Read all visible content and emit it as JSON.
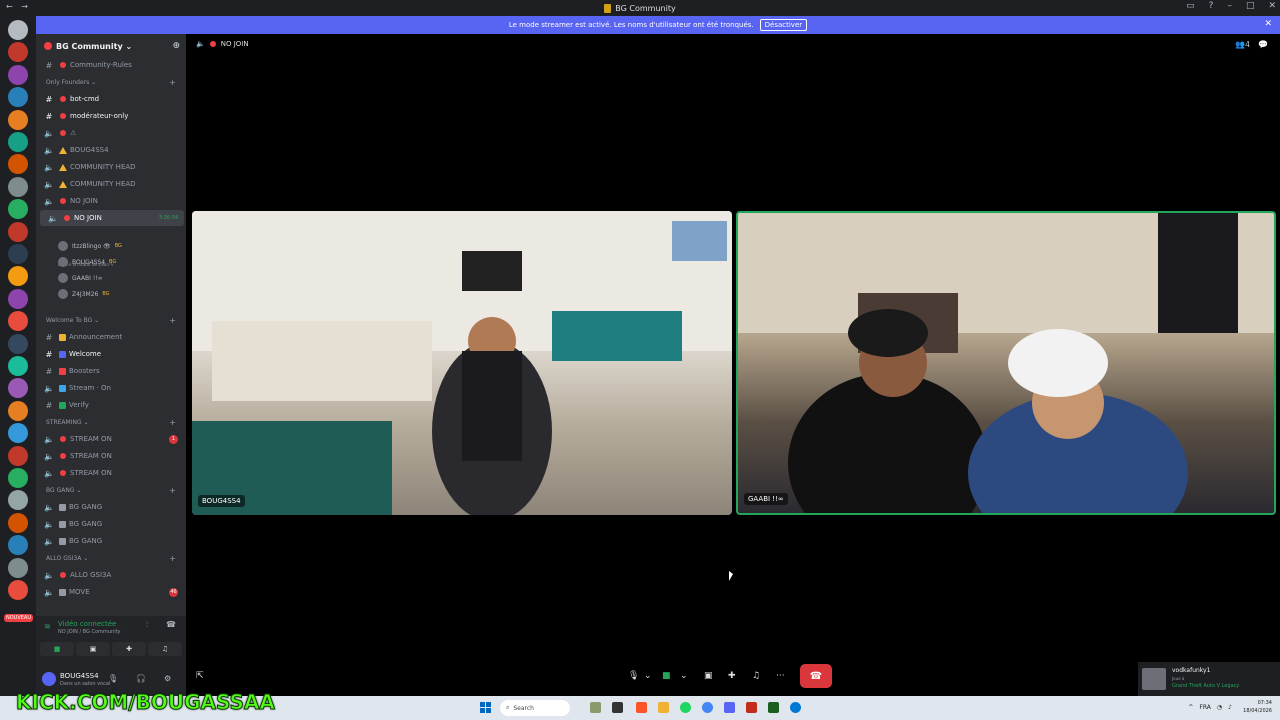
{
  "window": {
    "title": "BG Community",
    "controls": [
      "▭",
      "?",
      "–",
      "□",
      "✕"
    ]
  },
  "banner": {
    "text": "Le mode streamer est activé. Les noms d'utilisateur ont été tronqués.",
    "button": "Désactiver"
  },
  "guild": {
    "name": "BG Community ⌄"
  },
  "channels": [
    {
      "kind": "hash",
      "dot": "#f23f43",
      "label": "Community-Rules"
    },
    {
      "kind": "cat",
      "label": "Only Founders ⌄"
    },
    {
      "kind": "hash",
      "dot": "#f23f43",
      "label": "bot-cmd",
      "bright": true
    },
    {
      "kind": "hash",
      "dot": "#f23f43",
      "label": "modérateur-only",
      "bright": true
    },
    {
      "kind": "voice",
      "dot": "#f23f43",
      "label": "⚠"
    },
    {
      "kind": "voice",
      "warn": true,
      "label": "BOUG4SS4"
    },
    {
      "kind": "voice",
      "warn": true,
      "label": "COMMUNITY HEAD"
    },
    {
      "kind": "voice",
      "warn": true,
      "label": "COMMUNITY HEAD"
    },
    {
      "kind": "voice",
      "dot": "#f23f43",
      "label": "NO JOIN"
    },
    {
      "kind": "voice",
      "dot": "#f23f43",
      "label": "NO JOIN",
      "active": true,
      "time": "3:26:54"
    }
  ],
  "voice_status_note": "Définir un statut de salon ✎",
  "voice_users": [
    {
      "name": "ItzzBlingo 👁",
      "tag": "BG"
    },
    {
      "name": "BOUG4SS4",
      "tag": "BG"
    },
    {
      "name": "GAABI !!∞",
      "tag": ""
    },
    {
      "name": "Z4J3M26",
      "tag": "BG"
    }
  ],
  "channels2": [
    {
      "kind": "cat",
      "label": "Welcome To BG ⌄"
    },
    {
      "kind": "hash",
      "sq": "#f0b232",
      "label": "Announcement"
    },
    {
      "kind": "hash",
      "sq": "#5865f2",
      "label": "Welcome",
      "bright": true
    },
    {
      "kind": "hash",
      "sq": "#f23f43",
      "label": "Boosters"
    },
    {
      "kind": "voice",
      "sq": "#3ba7e8",
      "label": "Stream · On"
    },
    {
      "kind": "hash",
      "sq": "#23a55a",
      "label": "Verify"
    },
    {
      "kind": "cat",
      "label": "STREAMING ⌄"
    },
    {
      "kind": "voice",
      "dot": "#f23f43",
      "label": "STREAM ON",
      "num": "1"
    },
    {
      "kind": "voice",
      "dot": "#f23f43",
      "label": "STREAM ON"
    },
    {
      "kind": "voice",
      "dot": "#f23f43",
      "label": "STREAM ON"
    },
    {
      "kind": "cat",
      "label": "BG GANG ⌄"
    },
    {
      "kind": "voice",
      "sq": "#949ba4",
      "label": "BG GANG"
    },
    {
      "kind": "voice",
      "sq": "#949ba4",
      "label": "BG GANG"
    },
    {
      "kind": "voice",
      "sq": "#949ba4",
      "label": "BG GANG"
    },
    {
      "kind": "cat",
      "label": "ALLO GSI3A ⌄"
    },
    {
      "kind": "voice",
      "dot": "#f23f43",
      "label": "ALLO GSI3A"
    },
    {
      "kind": "voice",
      "sq": "#949ba4",
      "label": "MOVE",
      "num": "46"
    }
  ],
  "connection": {
    "status": "Vidéo connectée",
    "location": "NO JOIN / BG Community"
  },
  "user": {
    "name": "BOUG4SS4",
    "status": "Dans un salon vocal"
  },
  "call": {
    "channel": "NO JOIN",
    "participant_count": "4"
  },
  "tiles": [
    {
      "label": "BOUG4SS4"
    },
    {
      "label": "GAABI !!∞"
    }
  ],
  "notification": {
    "name": "vodkafunky1",
    "sub": "Joue à",
    "game": "Grand Theft Auto V Legacy"
  },
  "overlay_text": "KICK.COM/BOUGASSAA",
  "taskbar": {
    "search": "Search",
    "tray": "FRA",
    "time": "07:34",
    "date": "18/04/2026"
  },
  "colors": {
    "accent": "#5865f2",
    "green": "#23a55a",
    "danger": "#da373c"
  }
}
